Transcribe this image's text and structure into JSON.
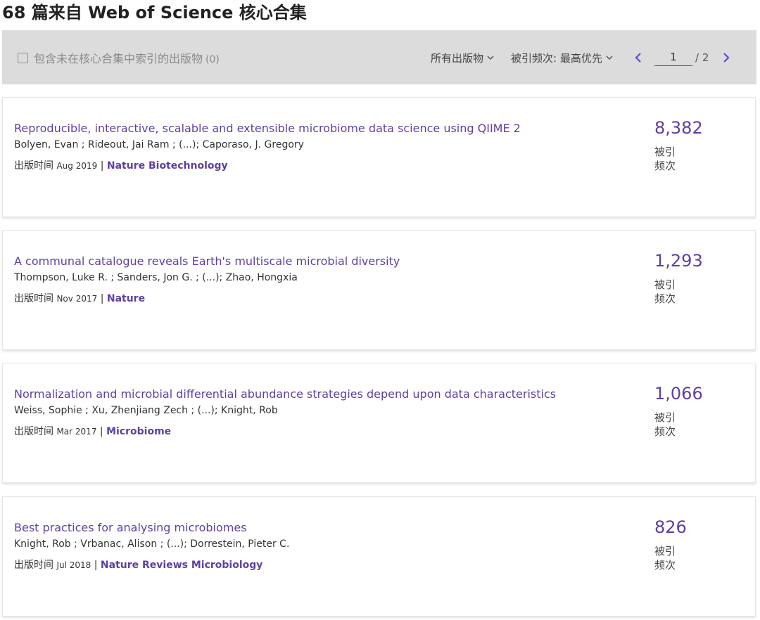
{
  "heading": {
    "count": "68",
    "text": "篇来自 Web of Science 核心合集"
  },
  "toolbar": {
    "include_label": "包含未在核心合集中索引的出版物",
    "include_count": "(0)",
    "publications_dropdown": "所有出版物",
    "sort_dropdown": "被引频次: 最高优先",
    "page_current": "1",
    "page_total": "/ 2"
  },
  "published_prefix": "出版时间",
  "cited_label": "被引频次",
  "results": [
    {
      "title": "Reproducible, interactive, scalable and extensible microbiome data science using QIIME 2",
      "authors": "Bolyen, Evan ; Rideout, Jai Ram ; (...); Caporaso, J. Gregory",
      "date": "Aug 2019",
      "journal": "Nature Biotechnology",
      "citations": "8,382"
    },
    {
      "title": "A communal catalogue reveals Earth's multiscale microbial diversity",
      "authors": "Thompson, Luke R. ; Sanders, Jon G. ; (...); Zhao, Hongxia",
      "date": "Nov 2017",
      "journal": "Nature",
      "citations": "1,293"
    },
    {
      "title": "Normalization and microbial differential abundance strategies depend upon data characteristics",
      "authors": "Weiss, Sophie ; Xu, Zhenjiang Zech ; (...); Knight, Rob",
      "date": "Mar 2017",
      "journal": "Microbiome",
      "citations": "1,066"
    },
    {
      "title": "Best practices for analysing microbiomes",
      "authors": "Knight, Rob ; Vrbanac, Alison ; (...); Dorrestein, Pieter C.",
      "date": "Jul 2018",
      "journal": "Nature Reviews Microbiology",
      "citations": "826"
    }
  ],
  "colors": {
    "accent": "#5f3fa3",
    "toolbar_bg": "#dcdcdc",
    "pager_arrow": "#5a4fcf"
  },
  "icons": {
    "checkbox": "checkbox-unchecked-icon",
    "dropdown": "chevron-down-icon",
    "prev": "chevron-left-icon",
    "next": "chevron-right-icon"
  }
}
